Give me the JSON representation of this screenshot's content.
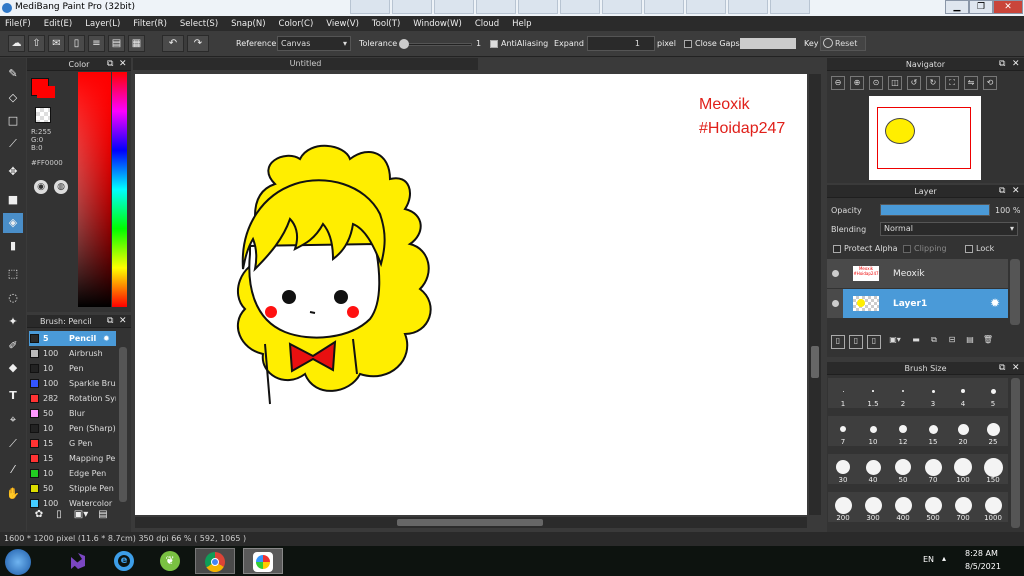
{
  "window": {
    "title": "MediBang Paint Pro (32bit)"
  },
  "menu": [
    "File(F)",
    "Edit(E)",
    "Layer(L)",
    "Filter(R)",
    "Select(S)",
    "Snap(N)",
    "Color(C)",
    "View(V)",
    "Tool(T)",
    "Window(W)",
    "Cloud",
    "Help"
  ],
  "toolbar": {
    "reference_label": "Reference",
    "reference_value": "Canvas",
    "tolerance_label": "Tolerance",
    "tolerance_value": "1",
    "antialiasing_label": "AntiAliasing",
    "expand_label": "Expand",
    "expand_value": "1",
    "expand_unit": "pixel",
    "close_gaps_label": "Close Gaps",
    "key_label": "Key",
    "reset_label": "Reset"
  },
  "color_panel": {
    "title": "Color",
    "r": "R:255",
    "g": "G:0",
    "b": "B:0",
    "hex": "#FF0000",
    "primary": "#ff0000"
  },
  "brush_panel": {
    "title": "Brush: Pencil",
    "items": [
      {
        "size": "5",
        "name": "Pencil",
        "color": "#2a2a2a"
      },
      {
        "size": "100",
        "name": "Airbrush",
        "color": "#bbbbbb"
      },
      {
        "size": "10",
        "name": "Pen",
        "color": "#222222"
      },
      {
        "size": "100",
        "name": "Sparkle Brush",
        "color": "#3355ff"
      },
      {
        "size": "282",
        "name": "Rotation Symmetry",
        "color": "#ff3333"
      },
      {
        "size": "50",
        "name": "Blur",
        "color": "#ff99ff"
      },
      {
        "size": "10",
        "name": "Pen (Sharp)",
        "color": "#222222"
      },
      {
        "size": "15",
        "name": "G Pen",
        "color": "#ff3333"
      },
      {
        "size": "15",
        "name": "Mapping Pen",
        "color": "#ff3333"
      },
      {
        "size": "10",
        "name": "Edge Pen",
        "color": "#22cc22"
      },
      {
        "size": "50",
        "name": "Stipple Pen",
        "color": "#dddd00"
      },
      {
        "size": "100",
        "name": "Watercolor",
        "color": "#44ccff"
      }
    ]
  },
  "canvas": {
    "tab_title": "Untitled",
    "text_line1": "Meoxik",
    "text_line2": "#Hoidap247"
  },
  "navigator": {
    "title": "Navigator"
  },
  "layer_panel": {
    "title": "Layer",
    "opacity_label": "Opacity",
    "opacity_value": "100 %",
    "opacity": 1.0,
    "blending_label": "Blending",
    "blending_value": "Normal",
    "protect_alpha": "Protect Alpha",
    "clipping": "Clipping",
    "lock": "Lock",
    "layers": [
      {
        "name": "Meoxik",
        "thumb_text": "Meoxik #Hoidap247",
        "selected": false
      },
      {
        "name": "Layer1",
        "selected": true
      }
    ]
  },
  "brush_size": {
    "title": "Brush Size",
    "sizes": [
      "1",
      "1.5",
      "2",
      "3",
      "4",
      "5",
      "7",
      "10",
      "12",
      "15",
      "20",
      "25",
      "30",
      "40",
      "50",
      "70",
      "100",
      "150",
      "200",
      "300",
      "400",
      "500",
      "700",
      "1000"
    ]
  },
  "statusbar": {
    "dims": "1600 * 1200 pixel",
    "cm": "(11.6 * 8.7cm)",
    "dpi": "350 dpi",
    "zoom": "66 %",
    "coords": "( 592, 1065 )"
  },
  "taskbar": {
    "lang": "EN",
    "time": "8:28 AM",
    "date": "8/5/2021"
  }
}
